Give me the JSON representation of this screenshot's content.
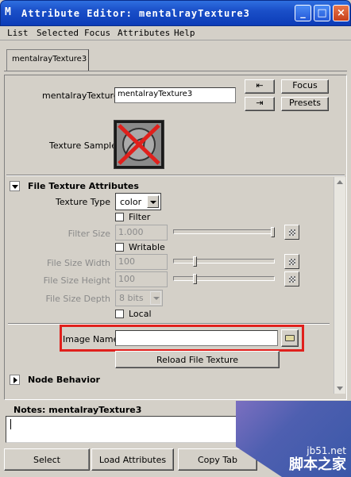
{
  "window": {
    "title": "Attribute Editor: mentalrayTexture3",
    "app_icon": "maya-icon"
  },
  "menu": [
    "List",
    "Selected",
    "Focus",
    "Attributes",
    "Help"
  ],
  "tab": {
    "label": "mentalrayTexture3"
  },
  "node": {
    "label": "mentalrayTexture:",
    "value": "mentalrayTexture3",
    "focus_label": "Focus",
    "presets_label": "Presets",
    "sample_label": "Texture Sample"
  },
  "file_texture": {
    "section_label": "File Texture Attributes",
    "texture_type_label": "Texture Type",
    "texture_type_value": "color",
    "filter_label": "Filter",
    "filter_size_label": "Filter Size",
    "filter_size_value": "1.000",
    "writable_label": "Writable",
    "file_size_width_label": "File Size Width",
    "file_size_width_value": "100",
    "file_size_height_label": "File Size Height",
    "file_size_height_value": "100",
    "file_size_depth_label": "File Size Depth",
    "file_size_depth_value": "8 bits",
    "local_label": "Local",
    "image_name_label": "Image Name",
    "image_name_value": "",
    "reload_label": "Reload File Texture"
  },
  "node_behavior": {
    "section_label": "Node Behavior"
  },
  "notes": {
    "label": "Notes: mentalrayTexture3",
    "value": ""
  },
  "bottom_buttons": {
    "select": "Select",
    "load": "Load Attributes",
    "copy": "Copy Tab"
  },
  "watermark": {
    "site": "jb51.net",
    "text": "脚本之家"
  },
  "colors": {
    "titlebar": "#1a4fc8",
    "highlight": "#e0201c",
    "panel": "#d4d0c8"
  }
}
